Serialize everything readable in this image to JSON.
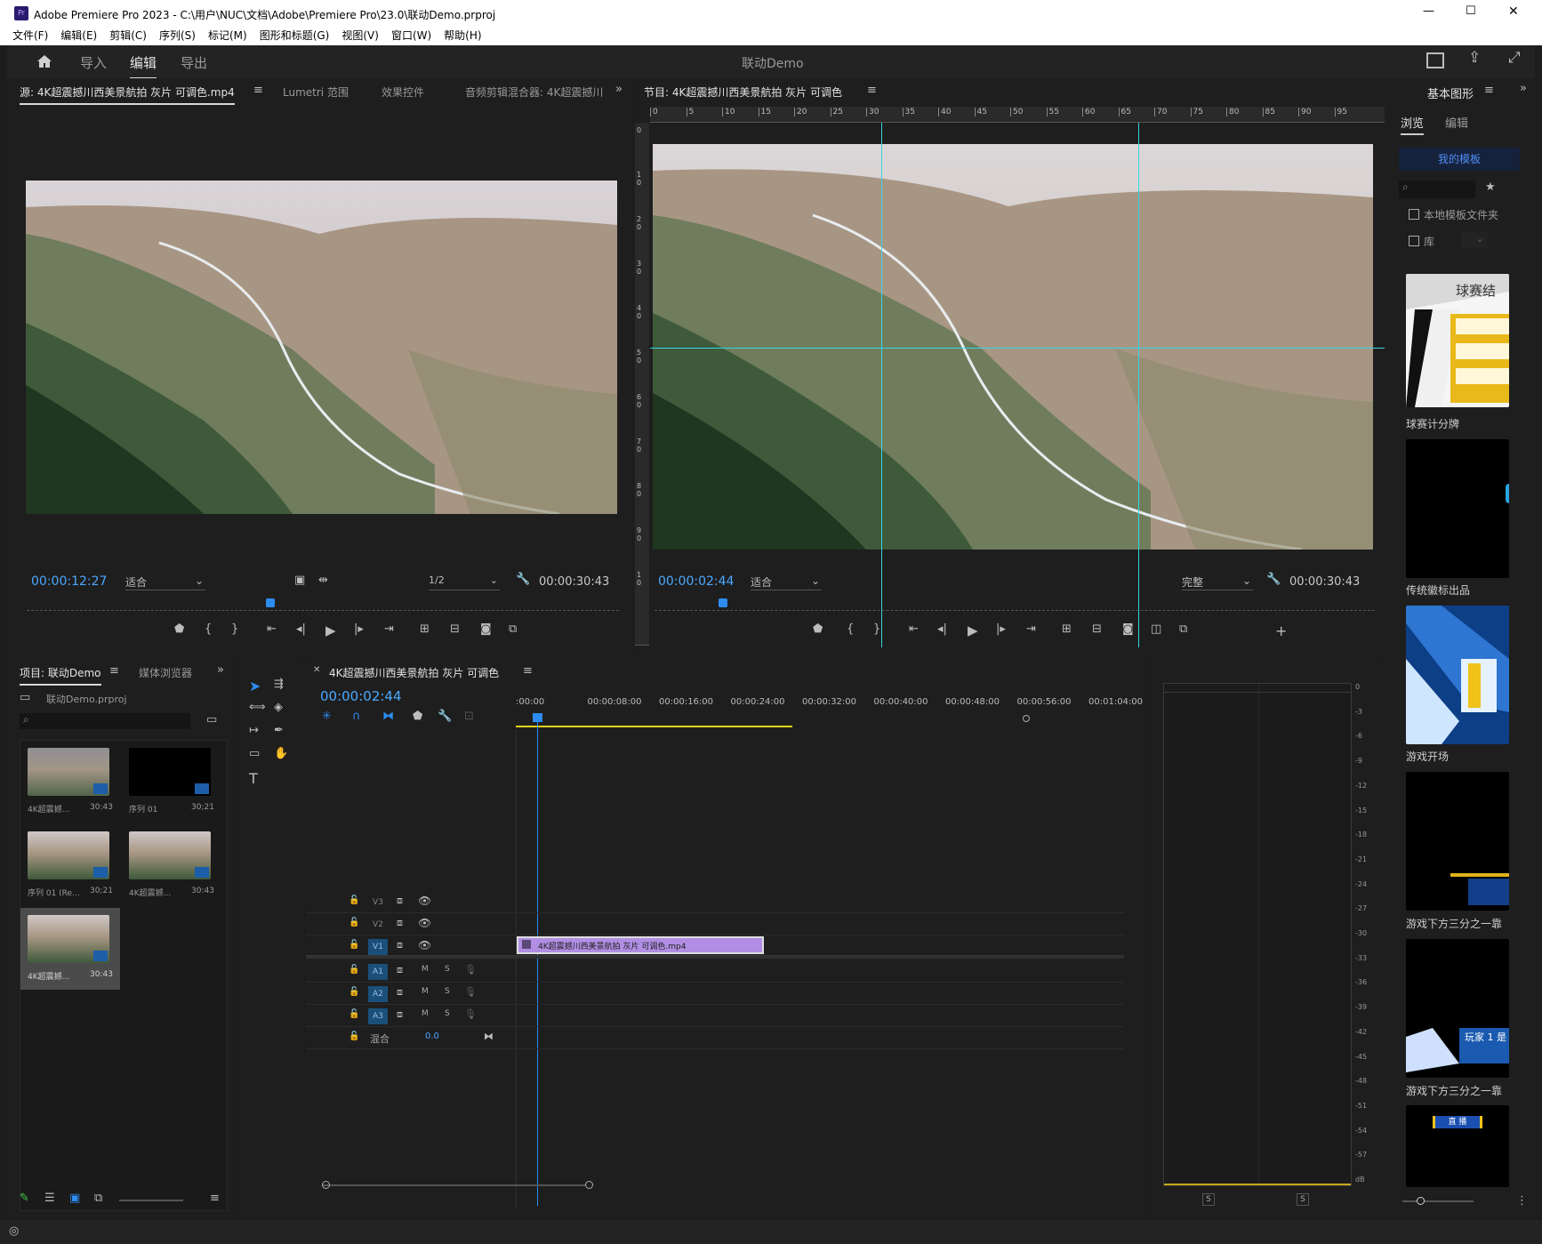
{
  "window": {
    "title": "Adobe Premiere Pro 2023 - C:\\用户\\NUC\\文档\\Adobe\\Premiere Pro\\23.0\\联动Demo.prproj",
    "app_icon": "Pr",
    "minimize": "—",
    "maximize": "☐",
    "close": "✕"
  },
  "menu": [
    "文件(F)",
    "编辑(E)",
    "剪辑(C)",
    "序列(S)",
    "标记(M)",
    "图形和标题(G)",
    "视图(V)",
    "窗口(W)",
    "帮助(H)"
  ],
  "workspace": {
    "home_icon": "home-icon",
    "tabs": [
      "导入",
      "编辑",
      "导出"
    ],
    "active_tab": "编辑",
    "project_title": "联动Demo"
  },
  "source_panel": {
    "tab_source": "源: 4K超震撼川西美景航拍 灰片 可调色.mp4",
    "tab_lumetri": "Lumetri 范围",
    "tab_effects": "效果控件",
    "tab_audio": "音频剪辑混合器: 4K超震撼川",
    "timecode": "00:00:12:27",
    "fit": "适合",
    "resolution": "1/2",
    "duration": "00:00:30:43",
    "playhead_fraction": 0.41
  },
  "program_panel": {
    "tab": "节目: 4K超震撼川西美景航拍 灰片 可调色",
    "timecode": "00:00:02:44",
    "fit": "适合",
    "quality": "完整",
    "duration": "00:00:30:43",
    "playhead_fraction": 0.09,
    "ruler_labels": [
      "0",
      "5",
      "10",
      "15",
      "20",
      "25",
      "30",
      "35",
      "40",
      "45",
      "50",
      "55",
      "60",
      "65",
      "70",
      "75",
      "80",
      "85",
      "90",
      "95"
    ],
    "vruler_labels": [
      "0",
      "1 0",
      "2 0",
      "3 0",
      "4 0",
      "5 0",
      "6 0",
      "7 0",
      "8 0",
      "9 0",
      "1 0"
    ]
  },
  "project_panel": {
    "tab_project": "项目: 联动Demo",
    "tab_media": "媒体浏览器",
    "file": "联动Demo.prproj",
    "items": [
      {
        "name": "4K超震撼...",
        "duration": "30:43"
      },
      {
        "name": "序列 01",
        "duration": "30;21"
      },
      {
        "name": "序列 01 (Re...",
        "duration": "30;21"
      },
      {
        "name": "4K超震撼...",
        "duration": "30:43"
      },
      {
        "name": "4K超震撼...",
        "duration": "30:43"
      }
    ]
  },
  "timeline": {
    "tab": "4K超震撼川西美景航拍 灰片 可调色",
    "timecode": "00:00:02:44",
    "ruler_labels": [
      ":00:00",
      "00:00:08:00",
      "00:00:16:00",
      "00:00:24:00",
      "00:00:32:00",
      "00:00:40:00",
      "00:00:48:00",
      "00:00:56:00",
      "00:01:04:00"
    ],
    "video_tracks": [
      "V3",
      "V2",
      "V1"
    ],
    "audio_tracks": [
      "A1",
      "A2",
      "A3"
    ],
    "mix_label": "混合",
    "mix_value": "0.0",
    "clip_label": "4K超震撼川西美景航拍 灰片 可调色.mp4",
    "m": "M",
    "s": "S"
  },
  "audio_meter": {
    "scale": [
      "0",
      "-3",
      "-6",
      "-9",
      "-12",
      "-15",
      "-18",
      "-21",
      "-24",
      "-27",
      "-30",
      "-33",
      "-36",
      "-39",
      "-42",
      "-45",
      "-48",
      "-51",
      "-54",
      "-57",
      "dB"
    ],
    "solo_left": "S",
    "solo_right": "S"
  },
  "essential_graphics": {
    "title": "基本图形",
    "tab_browse": "浏览",
    "tab_edit": "编辑",
    "my_templates": "我的模板",
    "local_folder": "本地模板文件夹",
    "library": "库",
    "templates": [
      {
        "name": "球赛计分牌",
        "art": "球赛结"
      },
      {
        "name": "传统徽标出品",
        "art": ""
      },
      {
        "name": "游戏开场",
        "art": ""
      },
      {
        "name": "游戏下方三分之一靠",
        "art": ""
      },
      {
        "name": "游戏下方三分之一靠",
        "art": "玩家 1 是"
      },
      {
        "name": "",
        "art": "直 播"
      }
    ]
  }
}
